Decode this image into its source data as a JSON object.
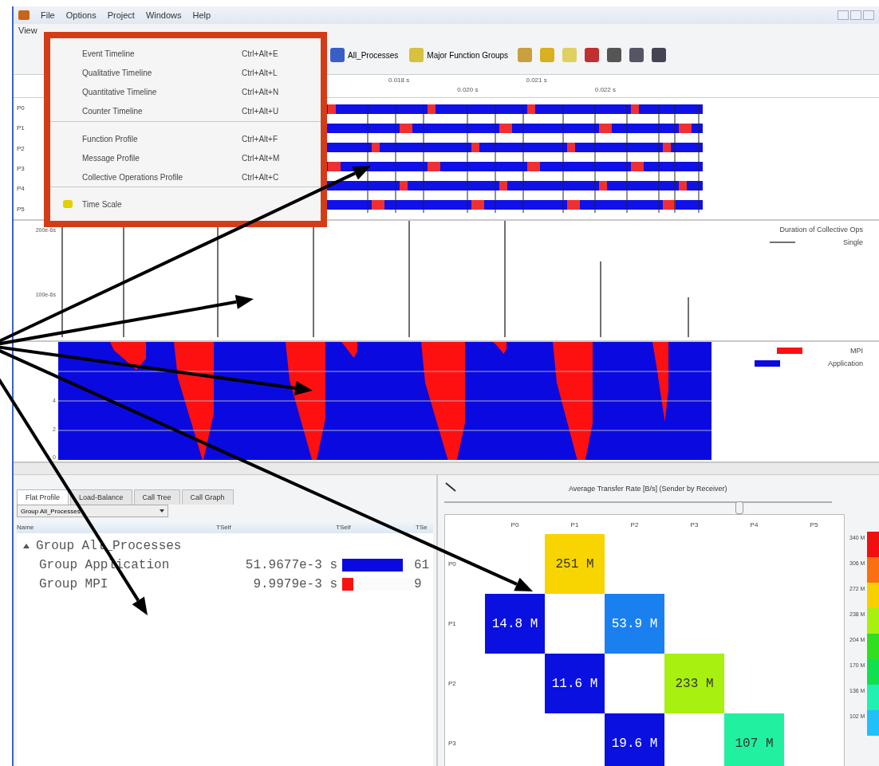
{
  "menu_bar": [
    "File",
    "Options",
    "Project",
    "Windows",
    "Help"
  ],
  "menu_bar_2": [
    "View"
  ],
  "toolbar": [
    {
      "label": "All_Processes",
      "kind": "group"
    },
    {
      "label": "Major Function Groups",
      "kind": "group"
    }
  ],
  "open_menu": {
    "items": [
      {
        "label": "Event Timeline",
        "shortcut": "Ctrl+Alt+E"
      },
      {
        "label": "Qualitative Timeline",
        "shortcut": "Ctrl+Alt+L"
      },
      {
        "label": "Quantitative Timeline",
        "shortcut": "Ctrl+Alt+N"
      },
      {
        "label": "Counter Timeline",
        "shortcut": "Ctrl+Alt+U",
        "separator_after": true
      },
      {
        "label": "Function Profile",
        "shortcut": "Ctrl+Alt+F"
      },
      {
        "label": "Message Profile",
        "shortcut": "Ctrl+Alt+M"
      },
      {
        "label": "Collective Operations Profile",
        "shortcut": "Ctrl+Alt+C",
        "separator_after": true
      },
      {
        "label": "Time Scale",
        "icon": true
      }
    ]
  },
  "time_ruler": [
    "0.018 s",
    "0.020 s",
    "0.021 s",
    "0.022 s"
  ],
  "timeline": {
    "processes": [
      "P0",
      "P1",
      "P2",
      "P3",
      "P4",
      "P5"
    ]
  },
  "collective_chart": {
    "yaxis": [
      "200e-6s",
      "100e-6s"
    ],
    "legend": [
      {
        "label": "Duration of Collective Ops",
        "kind": "title"
      },
      {
        "label": "Single",
        "kind": "line",
        "color": "#707070"
      }
    ]
  },
  "stacked_chart": {
    "yaxis": [
      "4",
      "2",
      "0"
    ],
    "legend": [
      {
        "label": "MPI",
        "color": "#ff1010"
      },
      {
        "label": "Application",
        "color": "#0a0ae0"
      }
    ]
  },
  "profile": {
    "tabs": [
      {
        "label": "Flat Profile",
        "selected": true
      },
      {
        "label": "Load-Balance",
        "selected": false
      },
      {
        "label": "Call Tree",
        "selected": false
      },
      {
        "label": "Call Graph",
        "selected": false
      }
    ],
    "dropdown": "Group All_Processes",
    "columns": [
      "Name",
      "TSelf",
      "TSelf",
      "TSe"
    ],
    "tree": [
      {
        "name": "Group All_Processes",
        "expanded": true,
        "children": [
          {
            "name": "Group Application",
            "tself": "51.9677e-3 s",
            "level": 0.84,
            "color": "#0a0ae0",
            "column_4": "61"
          },
          {
            "name": "Group MPI",
            "tself": "9.9979e-3 s",
            "level": 0.16,
            "color": "#ff1010",
            "column_4": "9"
          }
        ]
      }
    ]
  },
  "matrix": {
    "title": "Average Transfer Rate [B/s] (Sender by Receiver)",
    "level": 0.76,
    "columns": [
      "P0",
      "P1",
      "P2",
      "P3",
      "P4",
      "P5"
    ],
    "rows": [
      {
        "label": "P0",
        "cells": [
          null,
          {
            "value": "251 M",
            "color": "#f8d400"
          },
          null,
          null,
          null,
          null
        ]
      },
      {
        "label": "P1",
        "cells": [
          {
            "value": "14.8 M",
            "color": "#0a10e0"
          },
          null,
          {
            "value": "53.9 M",
            "color": "#1a80f0"
          },
          null,
          null,
          null
        ]
      },
      {
        "label": "P2",
        "cells": [
          null,
          {
            "value": "11.6 M",
            "color": "#0a10e0"
          },
          null,
          {
            "value": "233 M",
            "color": "#a8f010"
          },
          null,
          null
        ]
      },
      {
        "label": "P3",
        "cells": [
          null,
          null,
          {
            "value": "19.6 M",
            "color": "#0a10e0"
          },
          null,
          {
            "value": "107 M",
            "color": "#20f0a0"
          },
          null
        ]
      }
    ],
    "scale": [
      {
        "label": "340 M",
        "color": "#f01010"
      },
      {
        "label": "306 M",
        "color": "#f87010"
      },
      {
        "label": "272 M",
        "color": "#f8d000"
      },
      {
        "label": "238 M",
        "color": "#a8f010"
      },
      {
        "label": "204 M",
        "color": "#30e020"
      },
      {
        "label": "170 M",
        "color": "#10e050"
      },
      {
        "label": "136 M",
        "color": "#20f0b0"
      },
      {
        "label": "102 M",
        "color": "#20c0f8"
      }
    ]
  }
}
